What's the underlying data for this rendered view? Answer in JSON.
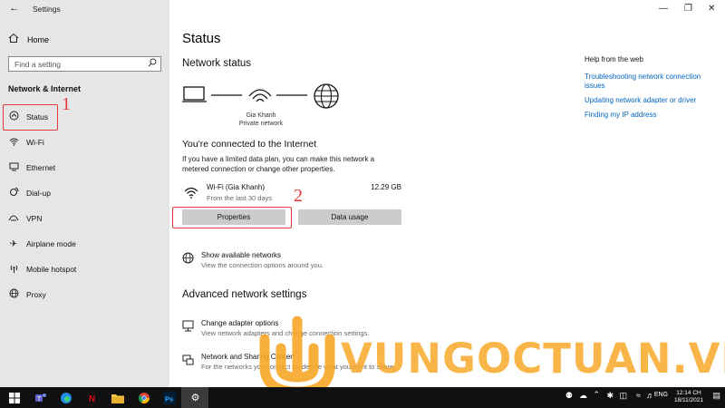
{
  "window": {
    "title": "Settings",
    "controls": [
      "minimize-icon",
      "maximize-icon",
      "close-icon"
    ]
  },
  "sidebar": {
    "home_label": "Home",
    "search": {
      "placeholder": "Find a setting",
      "value": ""
    },
    "section": "Network & Internet",
    "items": [
      {
        "label": "Status",
        "icon": "home-network-icon",
        "active": true
      },
      {
        "label": "Wi-Fi",
        "icon": "wifi-icon"
      },
      {
        "label": "Ethernet",
        "icon": "ethernet-icon"
      },
      {
        "label": "Dial-up",
        "icon": "dialup-icon"
      },
      {
        "label": "VPN",
        "icon": "vpn-icon"
      },
      {
        "label": "Airplane mode",
        "icon": "airplane-icon"
      },
      {
        "label": "Mobile hotspot",
        "icon": "hotspot-icon"
      },
      {
        "label": "Proxy",
        "icon": "globe-icon"
      }
    ]
  },
  "annotations": {
    "one": "1",
    "two": "2"
  },
  "main": {
    "title": "Status",
    "network_status": "Network status",
    "network_name": "Gia Khanh",
    "network_type": "Private network",
    "connected_title": "You're connected to the Internet",
    "connected_desc": "If you have a limited data plan, you can make this network a metered connection or change other properties.",
    "wifi": {
      "name": "Wi-Fi (Gia Khanh)",
      "period": "From the last 30 days",
      "usage": "12.29 GB"
    },
    "buttons": {
      "properties": "Properties",
      "data_usage": "Data usage"
    },
    "show_networks": {
      "title": "Show available networks",
      "sub": "View the connection options around you."
    },
    "advanced_title": "Advanced network settings",
    "change_adapter": {
      "title": "Change adapter options",
      "sub": "View network adapters and change connection settings."
    },
    "sharing_center": {
      "title": "Network and Sharing Center",
      "sub": "For the networks you connect to, decide what you want to share."
    }
  },
  "help": {
    "title": "Help from the web",
    "links": [
      "Troubleshooting network connection issues",
      "Updating network adapter or driver",
      "Finding my IP address"
    ]
  },
  "watermark": {
    "text": "VUNGOCTUAN.VN",
    "color": "#f8a828"
  },
  "taskbar": {
    "time": "12:14 CH",
    "date": "18/11/2021",
    "apps": [
      "windows-start-icon",
      "teams-icon",
      "edge-icon",
      "netflix-icon",
      "file-explorer-icon",
      "chrome-icon",
      "photoshop-icon",
      "settings-gear-icon"
    ]
  }
}
